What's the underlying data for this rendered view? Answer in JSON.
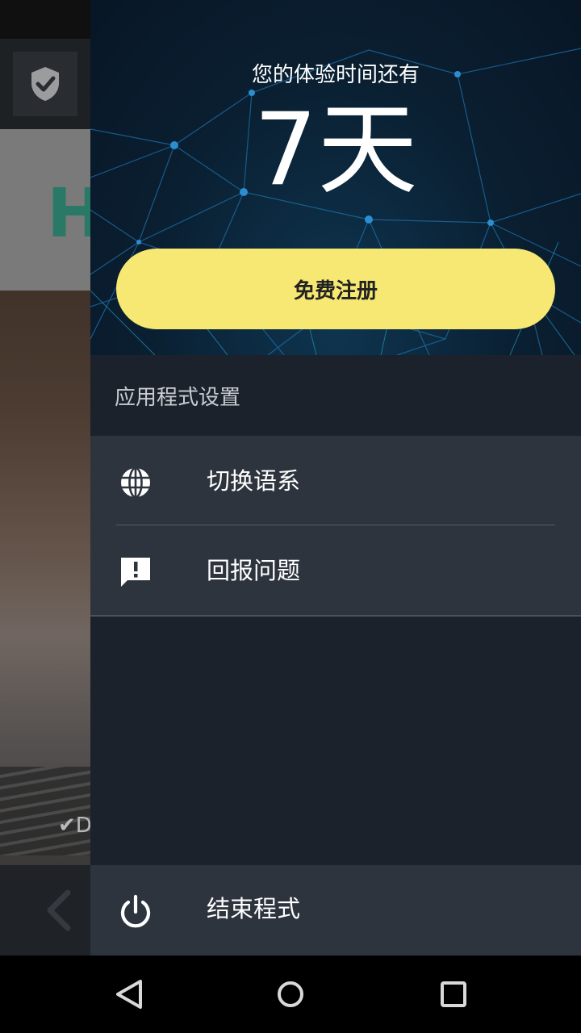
{
  "drawer": {
    "trial_text": "您的体验时间还有",
    "days_left": "7天",
    "register_label": "免费注册",
    "section_title": "应用程式设置",
    "menu_items": [
      {
        "label": "切换语系",
        "icon": "globe-icon"
      },
      {
        "label": "回报问题",
        "icon": "feedback-icon"
      }
    ],
    "exit_label": "结束程式",
    "exit_icon": "power-icon"
  },
  "background_app": {
    "logo_text": "H",
    "hero_check_text": "✔D"
  },
  "colors": {
    "register_button": "#f6e873",
    "drawer_bg": "#1c222c",
    "menu_bg": "#2d343e",
    "header_bg": "#0a1f31"
  }
}
